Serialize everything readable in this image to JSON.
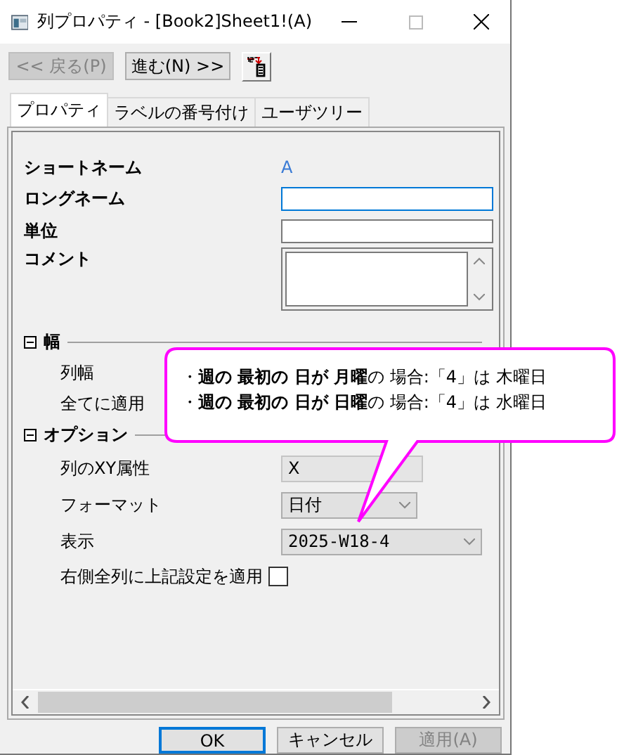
{
  "window": {
    "title": "列プロパティ - [Book2]Sheet1!(A)"
  },
  "toolbar": [
    {
      "kind": "button",
      "label": "<< 戻る(P)",
      "disabled": true
    },
    {
      "kind": "button",
      "label": "進む(N) >>",
      "disabled": false
    },
    {
      "kind": "icon"
    }
  ],
  "tabs": [
    {
      "label": "プロパティ",
      "selected": true
    },
    {
      "label": "ラベルの番号付け",
      "selected": false
    },
    {
      "label": "ユーザツリー",
      "selected": false
    }
  ],
  "properties": [
    {
      "kind": "static",
      "label": "ショートネーム",
      "value": "A"
    },
    {
      "kind": "text",
      "label": "ロングネーム",
      "focused": true
    },
    {
      "kind": "text",
      "label": "単位",
      "focused": false
    },
    {
      "kind": "textarea",
      "label": "コメント"
    }
  ],
  "sections": [
    {
      "title": "幅",
      "expanded": true,
      "items": [
        {
          "kind": "plain",
          "label": "列幅"
        },
        {
          "kind": "plain",
          "label": "全てに適用"
        }
      ]
    },
    {
      "title": "オプション",
      "expanded": true,
      "items": [
        {
          "kind": "readonly",
          "label": "列のXY属性",
          "value": "X"
        },
        {
          "kind": "select",
          "label": "フォーマット",
          "value": "日付"
        },
        {
          "kind": "select",
          "label": "表示",
          "value": "2025-W18-4"
        },
        {
          "kind": "checkbox",
          "label": "右側全列に上記設定を適用",
          "checked": false
        }
      ]
    }
  ],
  "callout": {
    "lines": [
      "・**週の 最初の 日が 月曜**の 場合:「4」は 木曜日",
      "・**週の 最初の 日が 日曜**の 場合:「4」は 水曜日"
    ]
  },
  "buttons": [
    {
      "label": "OK",
      "default": true,
      "disabled": false
    },
    {
      "label": "キャンセル",
      "default": false,
      "disabled": false
    },
    {
      "label": "適用(A)",
      "default": false,
      "disabled": true
    }
  ]
}
